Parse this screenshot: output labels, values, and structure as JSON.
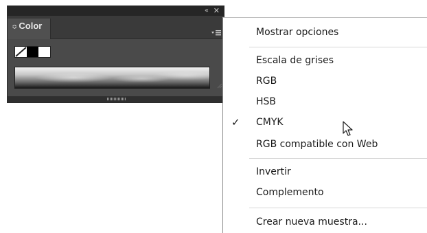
{
  "panel": {
    "title": "Color",
    "collapse_glyph": "«",
    "close_glyph": "✕",
    "updown_glyph": "≎",
    "swatches": [
      "none",
      "black",
      "white"
    ],
    "menu_icon": "panel-menu-icon"
  },
  "menu": {
    "items": [
      {
        "label": "Mostrar opciones",
        "checked": false
      },
      {
        "label": "Escala de grises",
        "checked": false
      },
      {
        "label": "RGB",
        "checked": false
      },
      {
        "label": "HSB",
        "checked": false
      },
      {
        "label": "CMYK",
        "checked": true
      },
      {
        "label": "RGB compatible con Web",
        "checked": false
      },
      {
        "label": "Invertir",
        "checked": false
      },
      {
        "label": "Complemento",
        "checked": false
      },
      {
        "label": "Crear nueva muestra...",
        "checked": false
      }
    ],
    "check_glyph": "✓"
  },
  "colors": {
    "panel_bg": "#4a4a4a",
    "panel_dark": "#262626",
    "menu_bg": "#ffffff",
    "separator": "#d6d6d6"
  }
}
